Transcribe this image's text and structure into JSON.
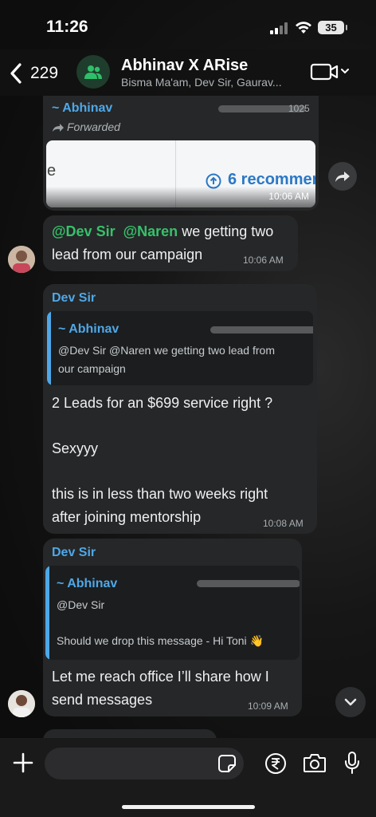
{
  "status_bar": {
    "time": "11:26",
    "battery": "35"
  },
  "header": {
    "back_count": "229",
    "title": "Abhinav X ARise",
    "subtitle": "Bisma Ma'am, Dev Sir, Gaurav..."
  },
  "messages": [
    {
      "sender": "~ Abhinav",
      "forwarded_label": "Forwarded",
      "header_partial": "1025",
      "image_left_text": "e",
      "image_right_text": "6 recommen",
      "time": "10:06 AM"
    },
    {
      "mention_1": "@Dev Sir",
      "mention_2": "@Naren",
      "text_rest": "we getting two",
      "text_line2": "lead from our campaign",
      "time": "10:06 AM"
    },
    {
      "sender": "Dev Sir",
      "quote_sender": "~ Abhinav",
      "quote_line1": "@Dev Sir  @Naren we getting two lead from",
      "quote_line2": "our campaign",
      "line1": "2 Leads for an $699 service right ?",
      "line2": "Sexyyy",
      "line3": "this is in less than two weeks right",
      "line4": "after joining mentorship",
      "time": "10:08 AM"
    },
    {
      "sender": "Dev Sir",
      "quote_sender": "~ Abhinav",
      "quote_line1": "@Dev Sir",
      "quote_line2": "Should we drop this message - Hi Toni 👋",
      "line1": "Let me reach office I’ll share how I",
      "line2": "send messages",
      "time": "10:09 AM"
    }
  ],
  "colors": {
    "background": "#101010",
    "bubble": "#262728",
    "sender_blue": "#4ea8e8",
    "mention_green": "#37c16b",
    "group_avatar": "#1f3d2c"
  },
  "icons": [
    "back-chevron-icon",
    "group-icon",
    "video-call-icon",
    "chevron-down-icon",
    "forward-icon",
    "arrow-down-icon",
    "plus-icon",
    "sticker-icon",
    "rupee-icon",
    "camera-icon",
    "microphone-icon"
  ]
}
